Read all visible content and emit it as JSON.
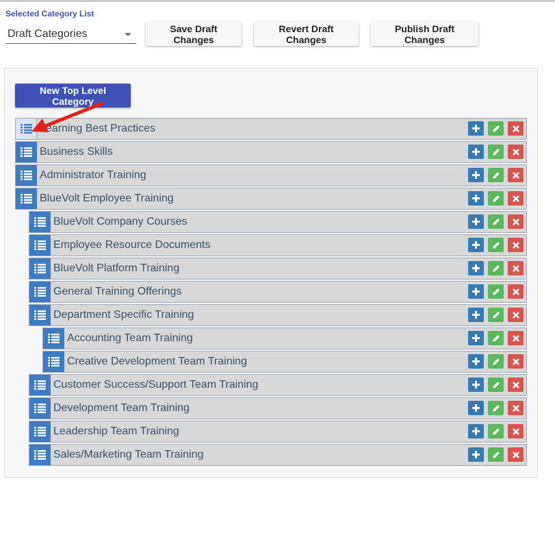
{
  "header": {
    "list_label": "Selected Category List",
    "selected_list": "Draft Categories",
    "save_label": "Save Draft Changes",
    "revert_label": "Revert Draft Changes",
    "publish_label": "Publish Draft Changes"
  },
  "panel": {
    "new_top_label": "New Top Level Category"
  },
  "categories": [
    {
      "label": "Learning Best Practices",
      "level": 0
    },
    {
      "label": "Business Skills",
      "level": 0
    },
    {
      "label": "Administrator Training",
      "level": 0
    },
    {
      "label": "BlueVolt Employee Training",
      "level": 0
    },
    {
      "label": "BlueVolt Company Courses",
      "level": 1
    },
    {
      "label": "Employee Resource Documents",
      "level": 1
    },
    {
      "label": "BlueVolt Platform Training",
      "level": 1
    },
    {
      "label": "General Training Offerings",
      "level": 1
    },
    {
      "label": "Department Specific Training",
      "level": 1
    },
    {
      "label": "Accounting Team Training",
      "level": 2
    },
    {
      "label": "Creative Development Team Training",
      "level": 2
    },
    {
      "label": "Customer Success/Support Team Training",
      "level": 1
    },
    {
      "label": "Development Team Training",
      "level": 1
    },
    {
      "label": "Leadership Team Training",
      "level": 1
    },
    {
      "label": "Sales/Marketing Team Training",
      "level": 1
    }
  ],
  "icons": {
    "handle": "list-icon",
    "add": "plus-icon",
    "edit": "pencil-icon",
    "delete": "times-icon",
    "annotation": "red-arrow"
  },
  "colors": {
    "primary": "#3f51b5",
    "handle": "#3d7cc2",
    "add": "#337ab7",
    "edit": "#5cb85c",
    "delete": "#d9534f",
    "annotation": "#e8201b"
  }
}
